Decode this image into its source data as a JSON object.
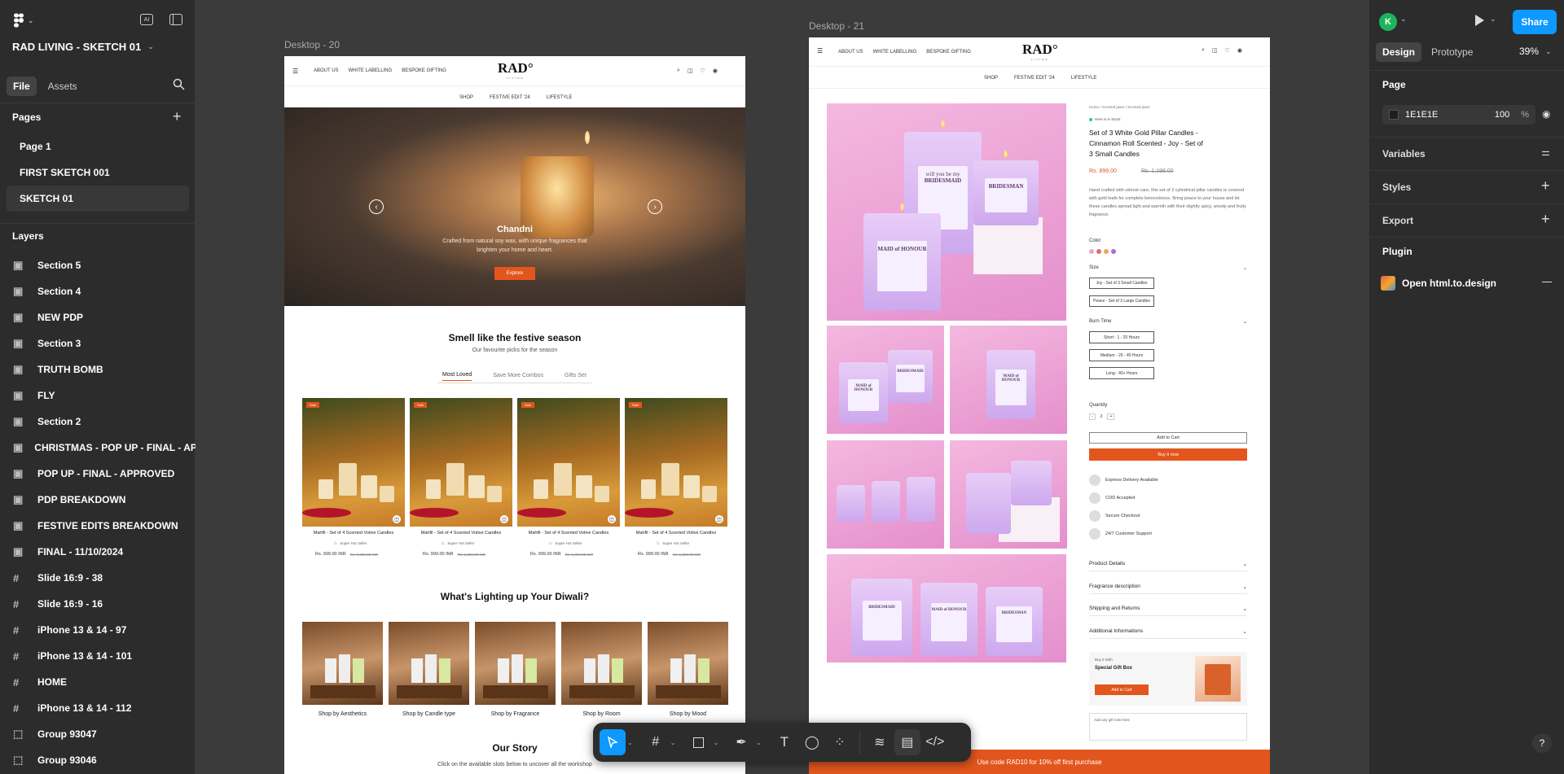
{
  "left_panel": {
    "file_name": "RAD LIVING - SKETCH 01",
    "tabs": [
      "File",
      "Assets"
    ],
    "pages_heading": "Pages",
    "pages": [
      "Page 1",
      "FIRST SKETCH 001",
      "SKETCH 01"
    ],
    "selected_page": "SKETCH 01",
    "layers_heading": "Layers",
    "layers": [
      {
        "name": "Section 5",
        "icon": "section-icon"
      },
      {
        "name": "Section 4",
        "icon": "section-icon"
      },
      {
        "name": "NEW PDP",
        "icon": "section-icon"
      },
      {
        "name": "Section 3",
        "icon": "section-icon"
      },
      {
        "name": "TRUTH BOMB",
        "icon": "section-icon"
      },
      {
        "name": "FLY",
        "icon": "section-icon"
      },
      {
        "name": "Section 2",
        "icon": "section-icon"
      },
      {
        "name": "CHRISTMAS - POP UP - FINAL - APPR",
        "icon": "section-icon"
      },
      {
        "name": "POP UP - FINAL - APPROVED",
        "icon": "section-icon"
      },
      {
        "name": "PDP BREAKDOWN",
        "icon": "section-icon"
      },
      {
        "name": "FESTIVE EDITS BREAKDOWN",
        "icon": "section-icon"
      },
      {
        "name": "FINAL - 11/10/2024",
        "icon": "section-icon"
      },
      {
        "name": "Slide 16:9 - 38",
        "icon": "frame-icon"
      },
      {
        "name": "Slide 16:9 - 16",
        "icon": "frame-icon"
      },
      {
        "name": "iPhone 13 & 14 - 97",
        "icon": "frame-icon"
      },
      {
        "name": "iPhone 13 & 14 - 101",
        "icon": "frame-icon"
      },
      {
        "name": "HOME",
        "icon": "frame-icon"
      },
      {
        "name": "iPhone 13 & 14 - 112",
        "icon": "frame-icon"
      },
      {
        "name": "Group 93047",
        "icon": "group-icon"
      },
      {
        "name": "Group 93046",
        "icon": "group-icon"
      }
    ]
  },
  "right_panel": {
    "avatar_letter": "K",
    "share_label": "Share",
    "tabs": [
      "Design",
      "Prototype"
    ],
    "zoom": "39%",
    "page_heading": "Page",
    "page_color": "1E1E1E",
    "page_opacity": "100",
    "percent": "%",
    "sections": [
      "Variables",
      "Styles",
      "Export"
    ],
    "plugin_heading": "Plugin",
    "plugin_name": "Open html.to.design",
    "help": "?"
  },
  "canvas": {
    "frame_a_label": "Desktop - 20",
    "frame_b_label": "Desktop - 21"
  },
  "site": {
    "logo": "RAD°",
    "logo_sub": "LIVING",
    "nav_top": [
      "ABOUT US",
      "WHITE LABELLING",
      "BESPOKE GIFTING"
    ],
    "nav_main": [
      "SHOP",
      "FESTIVE EDIT '24",
      "LIFESTYLE"
    ],
    "hero": {
      "title": "Chandni",
      "text": "Crafted from natural soy wax, with unique fragrances that brighten your home and heart.",
      "cta": "Explore"
    },
    "festive": {
      "title": "Smell like the festive season",
      "subtitle": "Our favourite picks for the season",
      "tabs": [
        "Most Loved",
        "Save More Combos",
        "Gifts Set"
      ]
    },
    "products": [
      {
        "name": "Mahfil - Set of 4 Scented Votive Candles",
        "badge": "Super Hot Seller",
        "price": "Rs. 999.00 INR",
        "old": "Rs. 1,399.00 INR",
        "tag": "Sale"
      },
      {
        "name": "Mahfil - Set of 4 Scented Votive Candles",
        "badge": "Super Hot Seller",
        "price": "Rs. 999.00 INR",
        "old": "Rs. 1,399.00 INR",
        "tag": "Sale"
      },
      {
        "name": "Mahfil - Set of 4 Scented Votive Candles",
        "badge": "Super Hot Seller",
        "price": "Rs. 999.00 INR",
        "old": "Rs. 1,399.00 INR",
        "tag": "Sale"
      },
      {
        "name": "Mahfil - Set of 4 Scented Votive Candles",
        "badge": "Super Hot Seller",
        "price": "Rs. 999.00 INR",
        "old": "Rs. 1,399.00 INR",
        "tag": "Sale"
      }
    ],
    "diwali_title": "What's Lighting up Your Diwali?",
    "shop_by": [
      "Shop by Aesthetics",
      "Shop by Candle type",
      "Shop by Fragrance",
      "Shop by Room",
      "Shop by Mood"
    ],
    "story_title": "Our Story",
    "story_text": "Click on the available slots below to uncover all the workshop"
  },
  "pdp": {
    "breadcrumb": "Home / Scented jaars / Scented jaars",
    "stock": "Here is in Stock",
    "title": "Set of 3 White Gold Pillar Candles - Cinnamon Roll Scented - Joy - Set of 3 Small Candles",
    "price": "Rs. 899.00",
    "old_price": "Rs. 1,199.00",
    "description": "Hand crafted with utmost care, this set of 3 cylindrical pillar candles is covered with gold leafs for complete benevolence. Bring peace to your house and let these candles spread light and warmth with their slightly spicy, woody and fruity fragrance.",
    "color_label": "Color",
    "colors": [
      "#e8a8c8",
      "#e36c6c",
      "#f0a070",
      "#a86ce0"
    ],
    "size_label": "Size",
    "sizes": [
      "Joy - Set of 3 Small Candles",
      "Peace - Set of 3 Large Candles"
    ],
    "burn_label": "Burn Time",
    "burns": [
      "Short - 1 - 20 Hours",
      "Medium - 20 - 40 Hours",
      "Long - 40+ Hours"
    ],
    "qty_label": "Quantity",
    "qty": "2",
    "qty_minus": "-",
    "qty_plus": "+",
    "add_to_cart": "Add to Cart",
    "buy_now": "Buy it now",
    "perks": [
      "Express Delivery Available",
      "COD Accepted",
      "Secure Checkout",
      "24/7 Customer Support"
    ],
    "accordions": [
      "Product Details",
      "Fragrance description",
      "Shipping and Returns",
      "Additional Informations"
    ],
    "buy_with": "Buy It With",
    "gift_title": "Special Gift Box",
    "gift_cta": "Add to Cart",
    "gift_note": "Add any gift note here",
    "promo": "Use code RAD10 for 10% off first purchase",
    "candle_text_1": "will you be my",
    "candle_text_2": "BRIDESMAID",
    "candle_text_3": "MAID of HONOUR",
    "candle_text_4": "BRIDESMAN"
  },
  "colors": {
    "accent_blue": "#0d99ff",
    "brand_orange": "#e2561d",
    "panel_bg": "#2c2c2c",
    "canvas_bg": "#3b3b3b"
  }
}
